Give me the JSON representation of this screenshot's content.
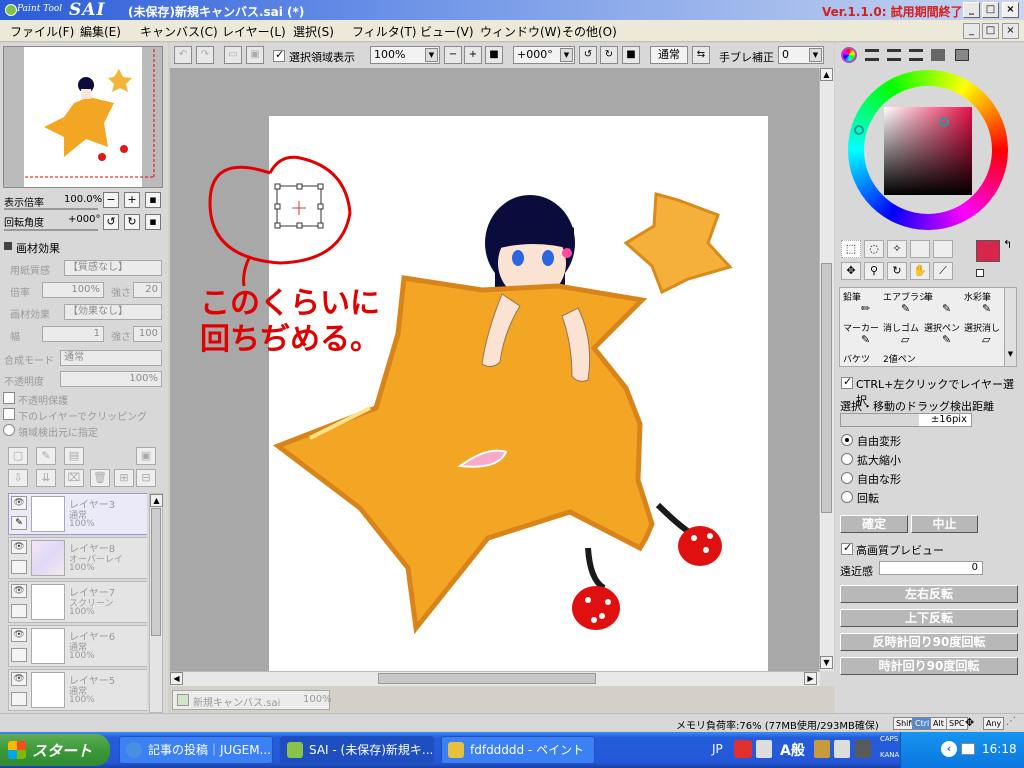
{
  "titlebar": {
    "logo_small": "Paint Tool",
    "logo_big": "SAI",
    "title": "(未保存)新規キャンバス.sai (*)",
    "version": "Ver.1.1.0: 試用期間終了"
  },
  "menu": [
    "ファイル(F)",
    "編集(E)",
    "キャンバス(C)",
    "レイヤー(L)",
    "選択(S)",
    "フィルタ(T)",
    "ビュー(V)",
    "ウィンドウ(W)",
    "その他(O)"
  ],
  "toolbar": {
    "select_display": "選択領域表示",
    "zoom": "100%",
    "angle": "+000°",
    "mode": "通常",
    "stabilizer_label": "手ブレ補正",
    "stabilizer_value": "0"
  },
  "left": {
    "zoom_label": "表示倍率",
    "zoom_value": "100.0%",
    "rotate_label": "回転角度",
    "rotate_value": "+000°",
    "texture_header": "画材効果",
    "paper_label": "用紙質感",
    "paper_value": "【質感なし】",
    "scale_label": "倍率",
    "scale_value": "100%",
    "strength_label": "強さ",
    "strength_value": "20",
    "material_label": "画材効果",
    "material_value": "【効果なし】",
    "width_label": "幅",
    "width_value": "1",
    "strength2_value": "100",
    "blend_label": "合成モード",
    "blend_value": "通常",
    "opacity_label": "不透明度",
    "opacity_value": "100%",
    "protect_label": "不透明保護",
    "clip_label": "下のレイヤーでクリッピング",
    "source_label": "領域検出元に指定"
  },
  "layers": [
    {
      "name": "レイヤー3",
      "mode": "通常",
      "opacity": "100%"
    },
    {
      "name": "レイヤー8",
      "mode": "オーバーレイ",
      "opacity": "100%"
    },
    {
      "name": "レイヤー7",
      "mode": "スクリーン",
      "opacity": "100%"
    },
    {
      "name": "レイヤー6",
      "mode": "通常",
      "opacity": "100%"
    },
    {
      "name": "レイヤー5",
      "mode": "通常",
      "opacity": "100%"
    }
  ],
  "canvas": {
    "annotation_line1": "このくらいに",
    "annotation_line2": "回ちぢめる。"
  },
  "doc_tab": {
    "name": "新規キャンバス.sai",
    "zoom": "100%"
  },
  "colors": {
    "primary": "#d8254a",
    "annotation": "#e00000",
    "star_fill": "#f2a624",
    "hair": "#0a0d3c"
  },
  "right": {
    "tools": [
      {
        "label": "鉛筆",
        "icon": "pencil-icon"
      },
      {
        "label": "エアブラシ",
        "icon": "airbrush-icon"
      },
      {
        "label": "筆",
        "icon": "brush-icon"
      },
      {
        "label": "水彩筆",
        "icon": "watercolor-icon"
      },
      {
        "label": "マーカー",
        "icon": "marker-icon"
      },
      {
        "label": "消しゴム",
        "icon": "eraser-icon"
      },
      {
        "label": "選択ペン",
        "icon": "select-pen-icon"
      },
      {
        "label": "選択消し",
        "icon": "select-erase-icon"
      },
      {
        "label": "バケツ",
        "icon": "bucket-icon"
      },
      {
        "label": "2値ペン",
        "icon": "binary-pen-icon"
      }
    ],
    "ctrl_select": "CTRL+左クリックでレイヤー選択",
    "drag_label": "選択・移動のドラッグ検出距離",
    "drag_value": "±16pix",
    "transform_options": [
      "自由変形",
      "拡大縮小",
      "自由な形",
      "回転"
    ],
    "ok_button": "確定",
    "cancel_button": "中止",
    "preview_label": "高画質プレビュー",
    "perspective_label": "遠近感",
    "perspective_value": "0",
    "flip_h": "左右反転",
    "flip_v": "上下反転",
    "rotate_ccw": "反時計回り90度回転",
    "rotate_cw": "時計回り90度回転"
  },
  "status": {
    "memory": "メモリ負荷率:76% (77MB使用/293MB確保)",
    "keys": [
      "Shift",
      "Ctrl",
      "Alt",
      "SPC",
      "Any"
    ]
  },
  "taskbar": {
    "start": "スタート",
    "tasks": [
      "記事の投稿｜JUGEM...",
      "SAI - (未保存)新規キ...",
      "fdfddddd - ペイント"
    ],
    "lang": "JP",
    "ime": "A般",
    "caps": "CAPS",
    "kana": "KANA",
    "time": "16:18"
  }
}
